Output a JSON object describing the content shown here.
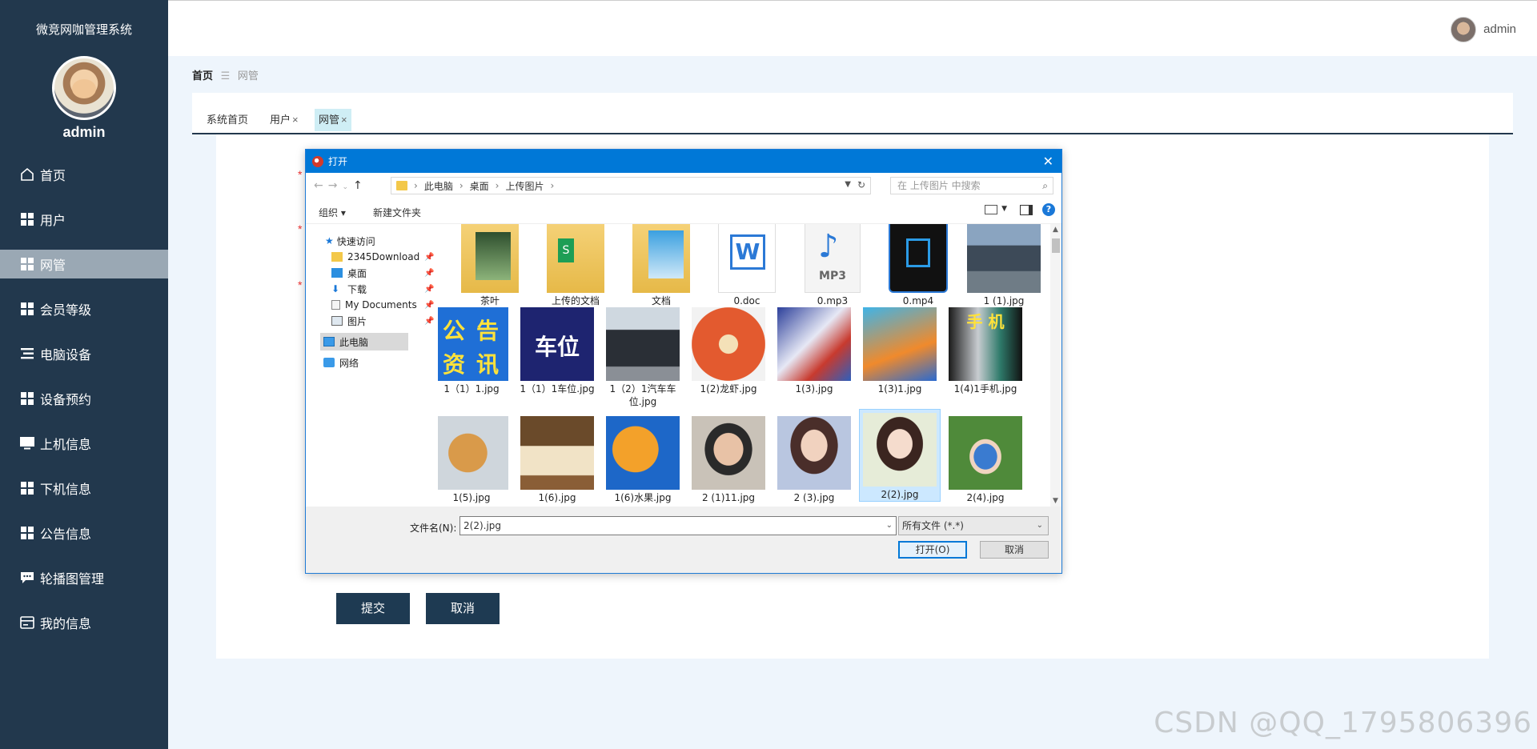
{
  "app": {
    "title": "微竞网咖管理系统",
    "username": "admin"
  },
  "sidebar": {
    "items": [
      {
        "label": "首页",
        "icon": "home-icon"
      },
      {
        "label": "用户",
        "icon": "grid-icon"
      },
      {
        "label": "网管",
        "icon": "grid-icon"
      },
      {
        "label": "会员等级",
        "icon": "grid-icon"
      },
      {
        "label": "电脑设备",
        "icon": "list-icon"
      },
      {
        "label": "设备预约",
        "icon": "grid-icon"
      },
      {
        "label": "上机信息",
        "icon": "monitor-icon"
      },
      {
        "label": "下机信息",
        "icon": "grid-icon"
      },
      {
        "label": "公告信息",
        "icon": "grid-icon"
      },
      {
        "label": "轮播图管理",
        "icon": "chat-icon"
      },
      {
        "label": "我的信息",
        "icon": "card-icon"
      }
    ],
    "active_index": 2
  },
  "topbar": {
    "username": "admin"
  },
  "breadcrumb": {
    "home": "首页",
    "separator": "☰",
    "current": "网管"
  },
  "tabs": [
    {
      "label": "系统首页",
      "closable": false
    },
    {
      "label": "用户",
      "closable": true
    },
    {
      "label": "网管",
      "closable": true
    }
  ],
  "form": {
    "submit_label": "提交",
    "cancel_label": "取消"
  },
  "dialog": {
    "title": "打开",
    "path": [
      "此电脑",
      "桌面",
      "上传图片"
    ],
    "search_placeholder": "在 上传图片 中搜索",
    "toolbar": {
      "organize": "组织 ▾",
      "new_folder": "新建文件夹"
    },
    "nav": [
      {
        "label": "快速访问",
        "icon": "star-icon"
      },
      {
        "label": "2345Download",
        "icon": "folder-icon",
        "pinned": true
      },
      {
        "label": "桌面",
        "icon": "desktop-icon",
        "pinned": true
      },
      {
        "label": "下载",
        "icon": "download-icon",
        "pinned": true
      },
      {
        "label": "My Documents",
        "icon": "document-icon",
        "pinned": true
      },
      {
        "label": "图片",
        "icon": "picture-icon",
        "pinned": true
      },
      {
        "label": "此电脑",
        "icon": "computer-icon",
        "selected": true
      },
      {
        "label": "网络",
        "icon": "network-icon"
      }
    ],
    "files": [
      {
        "name": "茶叶",
        "kind": "folder"
      },
      {
        "name": "上传的文档",
        "kind": "folder"
      },
      {
        "name": "文档",
        "kind": "folder"
      },
      {
        "name": "0.doc",
        "kind": "word"
      },
      {
        "name": "0.mp3",
        "kind": "mp3"
      },
      {
        "name": "0.mp4",
        "kind": "video"
      },
      {
        "name": "1 (1).jpg",
        "kind": "image"
      },
      {
        "name": "1（1）1.jpg",
        "kind": "image"
      },
      {
        "name": "1（1）1车位.jpg",
        "kind": "image"
      },
      {
        "name": "1（2）1汽车车位.jpg",
        "kind": "image"
      },
      {
        "name": "1(2)龙虾.jpg",
        "kind": "image"
      },
      {
        "name": "1(3).jpg",
        "kind": "image"
      },
      {
        "name": "1(3)1.jpg",
        "kind": "image"
      },
      {
        "name": "1(4)1手机.jpg",
        "kind": "image"
      },
      {
        "name": "1(5).jpg",
        "kind": "image"
      },
      {
        "name": "1(6).jpg",
        "kind": "image"
      },
      {
        "name": "1(6)水果.jpg",
        "kind": "image"
      },
      {
        "name": "2 (1)11.jpg",
        "kind": "image"
      },
      {
        "name": "2 (3).jpg",
        "kind": "image"
      },
      {
        "name": "2(2).jpg",
        "kind": "image",
        "selected": true
      },
      {
        "name": "2(4).jpg",
        "kind": "image"
      }
    ],
    "thumb_text": {
      "gg_a": "公",
      "gg_b": "告",
      "gg_c": "资",
      "gg_d": "讯",
      "chewei": "车位",
      "phone": "手 机",
      "mp3": "MP3",
      "doc": "W",
      "sheet": "S"
    },
    "filename_label": "文件名(N):",
    "filename_value": "2(2).jpg",
    "filetype_value": "所有文件 (*.*)",
    "open_label": "打开(O)",
    "cancel_label": "取消"
  },
  "watermark": "CSDN @QQ_1795806396",
  "colors": {
    "sidebar": "#22384d",
    "active_nav": "#9aa8b4",
    "dialog_title": "#0078d7",
    "button": "#1e3a52"
  }
}
